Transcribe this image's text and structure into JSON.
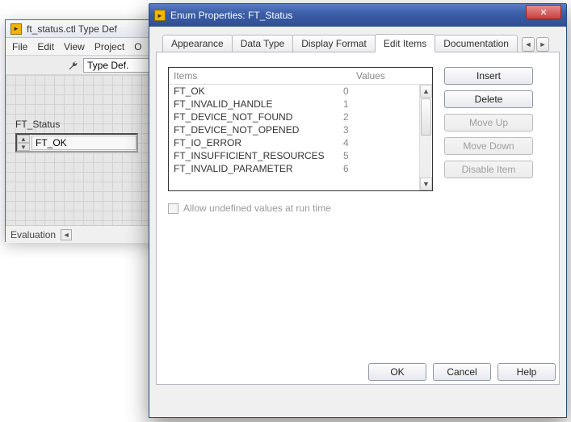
{
  "back_window": {
    "title": "ft_status.ctl Type Def",
    "menu": [
      "File",
      "Edit",
      "View",
      "Project",
      "O"
    ],
    "toolbar": {
      "typedef_label": "Type Def."
    },
    "control": {
      "label": "FT_Status",
      "value": "FT_OK"
    },
    "status": {
      "text": "Evaluation"
    }
  },
  "dialog": {
    "title": "Enum Properties: FT_Status",
    "tabs": [
      {
        "label": "Appearance"
      },
      {
        "label": "Data Type"
      },
      {
        "label": "Display Format"
      },
      {
        "label": "Edit Items",
        "active": true
      },
      {
        "label": "Documentation"
      }
    ],
    "items_header": {
      "col_items": "Items",
      "col_values": "Values"
    },
    "items": [
      {
        "name": "FT_OK",
        "value": "0"
      },
      {
        "name": "FT_INVALID_HANDLE",
        "value": "1"
      },
      {
        "name": "FT_DEVICE_NOT_FOUND",
        "value": "2"
      },
      {
        "name": "FT_DEVICE_NOT_OPENED",
        "value": "3"
      },
      {
        "name": "FT_IO_ERROR",
        "value": "4"
      },
      {
        "name": "FT_INSUFFICIENT_RESOURCES",
        "value": "5"
      },
      {
        "name": "FT_INVALID_PARAMETER",
        "value": "6"
      }
    ],
    "side_buttons": {
      "insert": "Insert",
      "delete": "Delete",
      "move_up": "Move Up",
      "move_down": "Move Down",
      "disable": "Disable Item"
    },
    "allow_undefined": "Allow undefined values at run time",
    "footer": {
      "ok": "OK",
      "cancel": "Cancel",
      "help": "Help"
    }
  }
}
